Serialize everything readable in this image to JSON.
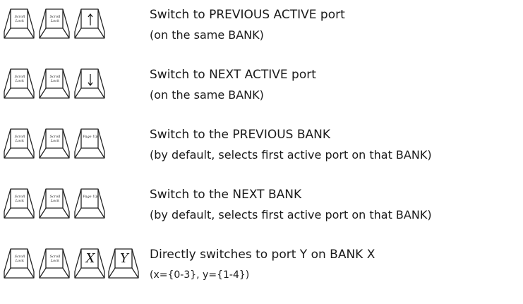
{
  "rows": [
    {
      "keys": [
        {
          "type": "text",
          "label": "Scroll Lock"
        },
        {
          "type": "text",
          "label": "Scroll Lock"
        },
        {
          "type": "arrow-up",
          "label": ""
        }
      ],
      "title": "Switch to PREVIOUS ACTIVE port",
      "note": "(on the same BANK)"
    },
    {
      "keys": [
        {
          "type": "text",
          "label": "Scroll Lock"
        },
        {
          "type": "text",
          "label": "Scroll Lock"
        },
        {
          "type": "arrow-down",
          "label": ""
        }
      ],
      "title": "Switch to NEXT ACTIVE port",
      "note": "(on the same BANK)"
    },
    {
      "keys": [
        {
          "type": "text",
          "label": "Scroll Lock"
        },
        {
          "type": "text",
          "label": "Scroll Lock"
        },
        {
          "type": "text",
          "label": "Page Up"
        }
      ],
      "title": "Switch to the PREVIOUS BANK",
      "note": "(by default, selects first active port on that BANK)"
    },
    {
      "keys": [
        {
          "type": "text",
          "label": "Scroll Lock"
        },
        {
          "type": "text",
          "label": "Scroll Lock"
        },
        {
          "type": "text",
          "label": "Page Up"
        }
      ],
      "title": "Switch to the NEXT BANK",
      "note": "(by default, selects first active port on that BANK)"
    },
    {
      "keys": [
        {
          "type": "text",
          "label": "Scroll Lock"
        },
        {
          "type": "text",
          "label": "Scroll Lock"
        },
        {
          "type": "glyph",
          "label": "X"
        },
        {
          "type": "glyph",
          "label": "Y"
        }
      ],
      "title": "Directly switches to port Y on BANK X",
      "note": "(x={0-3}, y={1-4})"
    }
  ]
}
